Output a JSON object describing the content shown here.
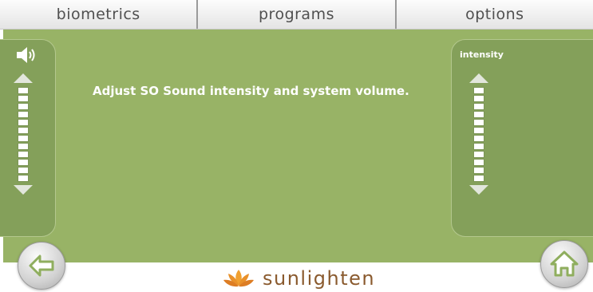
{
  "tabs": [
    {
      "label": "biometrics"
    },
    {
      "label": "programs"
    },
    {
      "label": "options"
    }
  ],
  "volume": {
    "icon": "speaker-volume-icon",
    "segments_total": 12,
    "segments_on": 12
  },
  "intensity": {
    "label": "intensity",
    "segments_total": 12,
    "segments_on": 12
  },
  "instruction": "Adjust SO Sound intensity and system volume.",
  "navigation": {
    "back_icon": "back-arrow-icon",
    "home_icon": "home-icon"
  },
  "brand": {
    "name": "sunlighten",
    "logo_icon": "lotus-logo-icon",
    "colors": {
      "name": "#8a5a2e",
      "petals": "#f0a030"
    }
  },
  "colors": {
    "panel_green": "#98b366",
    "side_panel_green": "#84a05a",
    "slider_white": "#ffffff"
  }
}
